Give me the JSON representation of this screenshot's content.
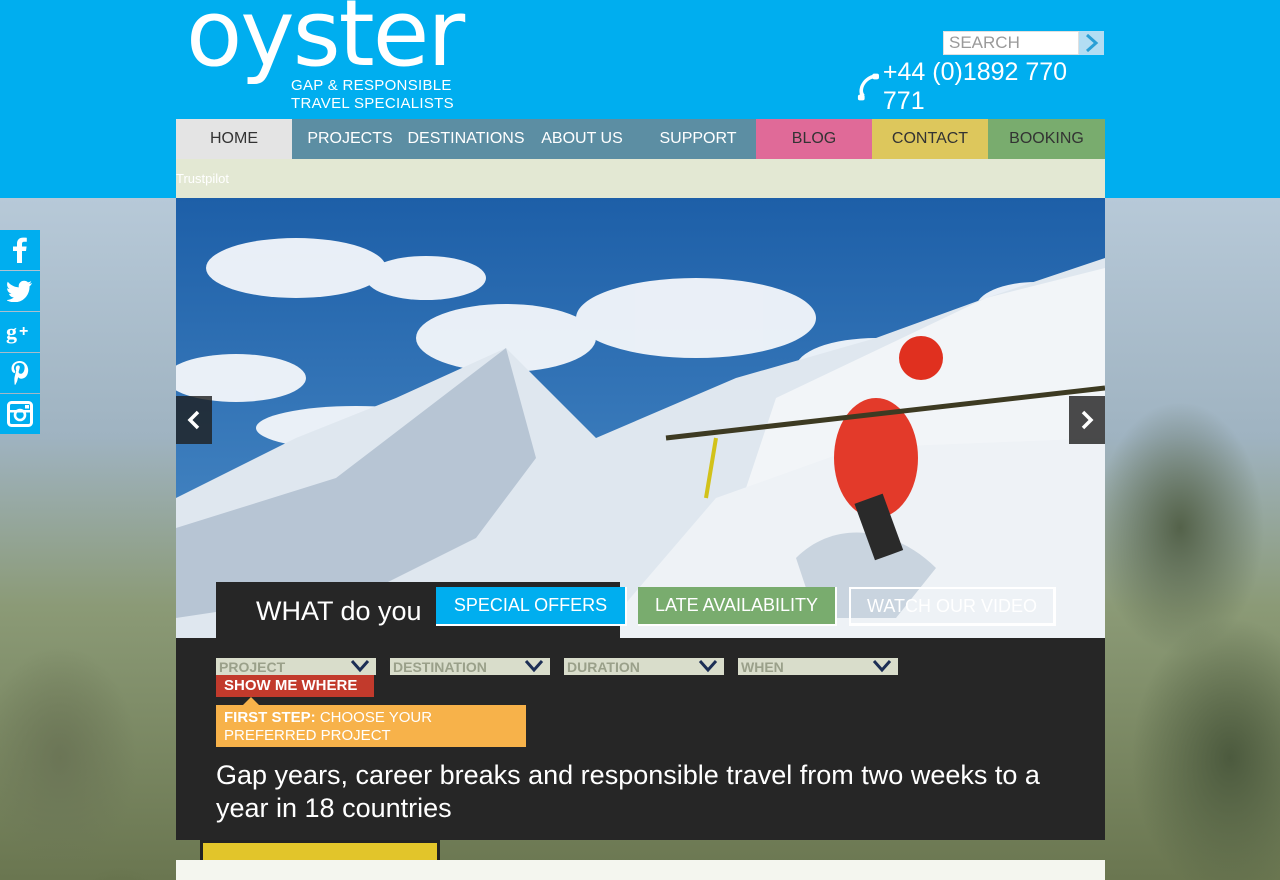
{
  "brand": {
    "logo_word": "oyster",
    "tagline_line1": "GAP & RESPONSIBLE",
    "tagline_line2": "TRAVEL SPECIALISTS",
    "accent_color": "#00aeef"
  },
  "search": {
    "placeholder": "SEARCH",
    "value": "",
    "submit_icon": "arrow-right-icon"
  },
  "phone": {
    "number": "+44 (0)1892 770 771",
    "icon": "phone-icon"
  },
  "nav": {
    "items": [
      {
        "label": "HOME",
        "bg": "#e4e4e4",
        "fg": "#333333"
      },
      {
        "label": "PROJECTS",
        "bg": "#5c8ea3",
        "fg": "#ffffff"
      },
      {
        "label": "DESTINATIONS",
        "bg": "#5c8ea3",
        "fg": "#ffffff"
      },
      {
        "label": "ABOUT US",
        "bg": "#5c8ea3",
        "fg": "#ffffff"
      },
      {
        "label": "SUPPORT",
        "bg": "#5c8ea3",
        "fg": "#ffffff"
      },
      {
        "label": "BLOG",
        "bg": "#e06a98",
        "fg": "#333333"
      },
      {
        "label": "CONTACT",
        "bg": "#ddc75c",
        "fg": "#333333"
      },
      {
        "label": "BOOKING",
        "bg": "#79ac6e",
        "fg": "#333333"
      }
    ]
  },
  "trust": {
    "label": "Trustpilot"
  },
  "social": {
    "items": [
      "facebook-icon",
      "twitter-icon",
      "google-plus-icon",
      "pinterest-icon",
      "instagram-icon"
    ]
  },
  "hero": {
    "prev_icon": "chevron-left-icon",
    "next_icon": "chevron-right-icon",
    "question": "WHAT do you"
  },
  "ctas": {
    "special_offers": "SPECIAL OFFERS",
    "late_availability": "LATE AVAILABILITY",
    "watch_video": "WATCH OUR VIDEO"
  },
  "finder": {
    "dropdowns": [
      "PROJECT",
      "DESTINATION",
      "DURATION",
      "WHEN"
    ],
    "submit": "SHOW ME WHERE",
    "tip_bold": "FIRST STEP:",
    "tip_text": " CHOOSE YOUR PREFERRED PROJECT"
  },
  "tagline": "Gap years, career breaks and responsible travel from two weeks to a year in 18 countries"
}
